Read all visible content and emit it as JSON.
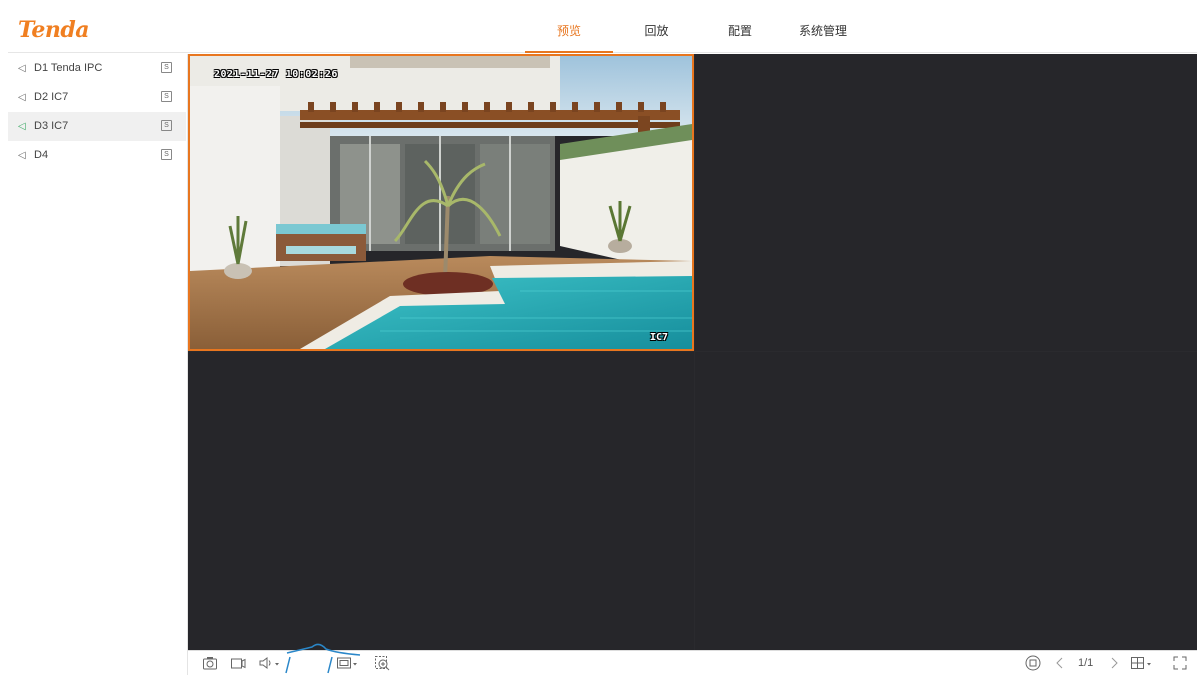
{
  "brand": {
    "logo_text": "Tenda",
    "color": "#f07f21"
  },
  "nav": {
    "active_index": 0,
    "tabs": [
      {
        "label": "预览"
      },
      {
        "label": "回放"
      },
      {
        "label": "配置"
      },
      {
        "label": "系统管理"
      }
    ]
  },
  "sidebar": {
    "devices": [
      {
        "label": "D1 Tenda IPC",
        "icon": "camera-icon",
        "selected": false,
        "online": false
      },
      {
        "label": "D2 IC7",
        "icon": "camera-icon",
        "selected": false,
        "online": false
      },
      {
        "label": "D3 IC7",
        "icon": "camera-icon",
        "selected": true,
        "online": true
      },
      {
        "label": "D4",
        "icon": "camera-icon",
        "selected": false,
        "online": false
      }
    ]
  },
  "grid": {
    "layout": "2x2",
    "panes": [
      {
        "osd_time": "2021-11-27 10:02:26",
        "osd_name": "IC7",
        "active": true,
        "has_video": true
      },
      {
        "has_video": false
      },
      {
        "has_video": false
      },
      {
        "has_video": false
      }
    ]
  },
  "toolbar": {
    "page_indicator": "1/1",
    "left_icons": [
      "snapshot-icon",
      "record-icon",
      "audio-icon",
      "stream-select-icon",
      "digital-zoom-icon"
    ],
    "right_icons": [
      "stop-all-icon",
      "prev-page-icon",
      "next-page-icon",
      "layout-select-icon",
      "fullscreen-icon"
    ]
  },
  "colors": {
    "accent": "#e8761f",
    "online": "#3aa864",
    "video_bg": "#26262a",
    "divider": "#4a4a4e"
  }
}
